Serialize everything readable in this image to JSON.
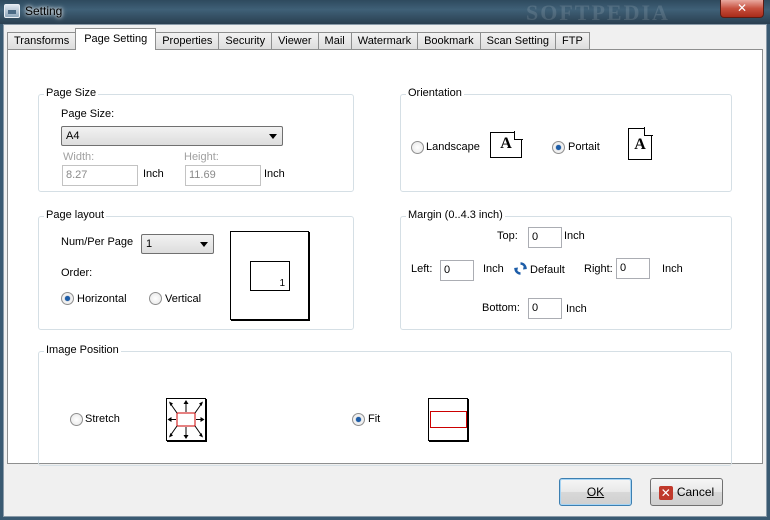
{
  "window": {
    "title": "Setting",
    "close": "✕"
  },
  "tabs": [
    "Transforms",
    "Page Setting",
    "Properties",
    "Security",
    "Viewer",
    "Mail",
    "Watermark",
    "Bookmark",
    "Scan Setting",
    "FTP"
  ],
  "page_size": {
    "group_title": "Page Size",
    "size_label": "Page Size:",
    "size_value": "A4",
    "width_label": "Width:",
    "width_value": "8.27",
    "width_unit": "Inch",
    "height_label": "Height:",
    "height_value": "11.69",
    "height_unit": "Inch"
  },
  "orientation": {
    "group_title": "Orientation",
    "landscape_label": "Landscape",
    "portrait_label": "Portait",
    "icon_letter": "A",
    "selected": "portrait"
  },
  "page_layout": {
    "group_title": "Page layout",
    "num_label": "Num/Per Page",
    "num_value": "1",
    "order_label": "Order:",
    "horizontal_label": "Horizontal",
    "vertical_label": "Vertical",
    "preview_number": "1",
    "selected": "horizontal"
  },
  "margin": {
    "group_title": "Margin (0..4.3 inch)",
    "top_label": "Top:",
    "top_value": "0",
    "left_label": "Left:",
    "left_value": "0",
    "right_label": "Right:",
    "right_value": "0",
    "bottom_label": "Bottom:",
    "bottom_value": "0",
    "unit": "Inch",
    "default_label": "Default"
  },
  "image_position": {
    "group_title": "Image Position",
    "stretch_label": "Stretch",
    "fit_label": "Fit",
    "selected": "fit"
  },
  "buttons": {
    "ok": "OK",
    "cancel": "Cancel"
  },
  "colors": {
    "accent": "#1d5da8",
    "red": "#cc0000",
    "title_bar": "#3f6077"
  },
  "watermark_text": "SOFTPEDIA"
}
